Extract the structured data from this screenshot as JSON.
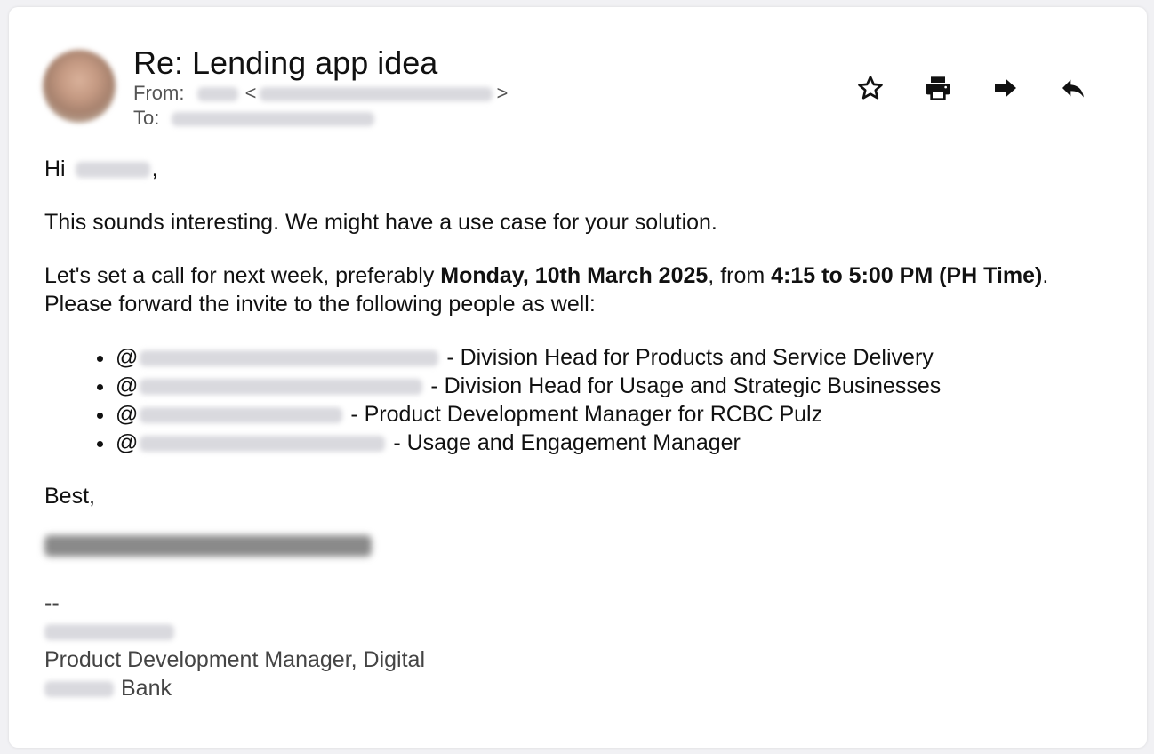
{
  "email": {
    "subject": "Re: Lending app idea",
    "from_label": "From:",
    "from_open": "<",
    "from_close": ">",
    "to_label": "To:"
  },
  "toolbar": {
    "star_icon": "star-icon",
    "print_icon": "print-icon",
    "forward_icon": "forward-icon",
    "reply_icon": "reply-icon"
  },
  "body": {
    "greeting_prefix": "Hi",
    "greeting_suffix": ",",
    "para1": "This sounds interesting. We might have a use case for your solution.",
    "para2_a": "Let's set a call for next week, preferably ",
    "para2_bold1": "Monday, 10th March 2025",
    "para2_b": ", from ",
    "para2_bold2": "4:15 to 5:00 PM (PH Time)",
    "para2_c": ". Please forward the invite to the following people as well:",
    "list": [
      {
        "at": "@",
        "role": " - Division Head for Products and Service Delivery"
      },
      {
        "at": "@",
        "role": " - Division Head for Usage and Strategic Businesses"
      },
      {
        "at": "@",
        "role": " - Product Development Manager for RCBC Pulz"
      },
      {
        "at": "@",
        "role": " - Usage and Engagement Manager"
      }
    ],
    "closing": "Best,"
  },
  "footer": {
    "dashes": "--",
    "title": "Product Development Manager, Digital",
    "bank_suffix": "Bank"
  }
}
